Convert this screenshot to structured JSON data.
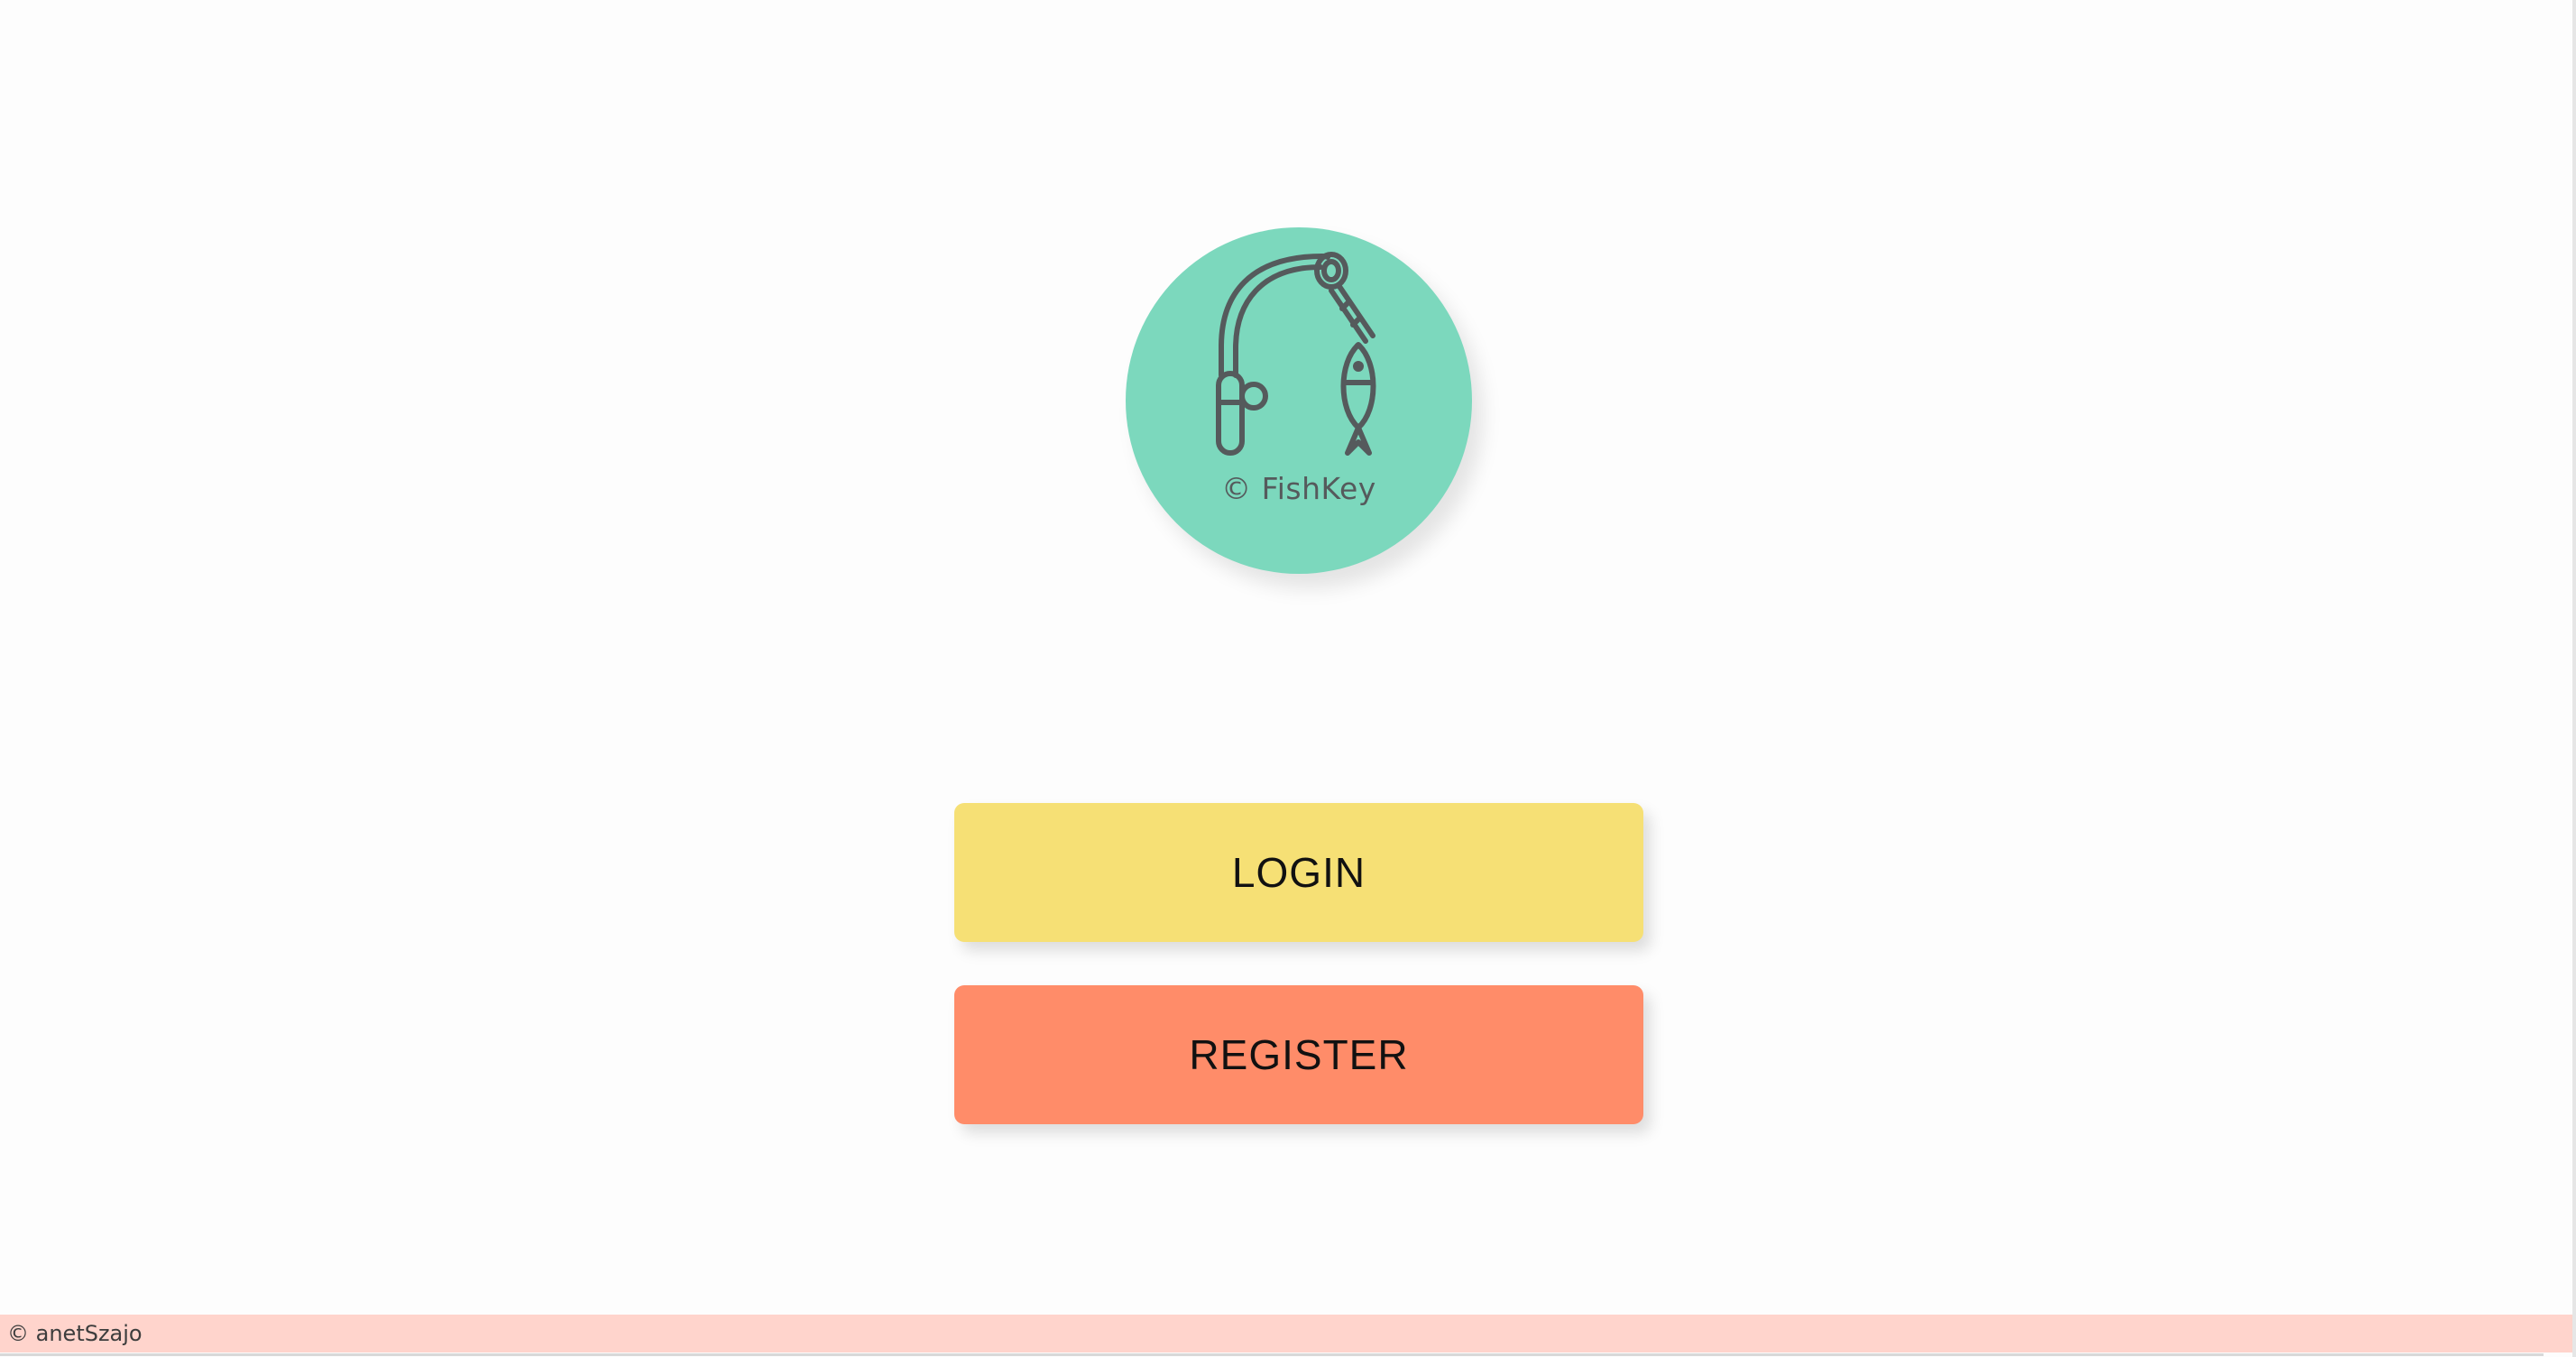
{
  "logo": {
    "text": "© FishKey",
    "icon": "fishing-rod-key-fish-icon",
    "color": "#7cd8bd"
  },
  "buttons": {
    "login_label": "LOGIN",
    "login_color": "#f6e075",
    "register_label": "REGISTER",
    "register_color": "#ff8c69"
  },
  "footer": {
    "text": "© anetSzajo",
    "color": "#ffd4cc"
  }
}
